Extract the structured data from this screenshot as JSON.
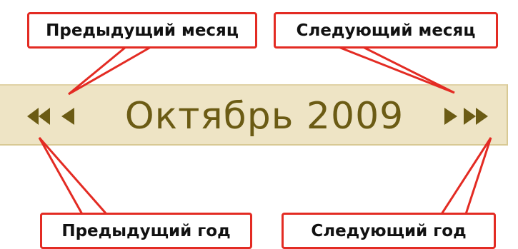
{
  "calendar_header": {
    "title": "Октябрь 2009",
    "colors": {
      "bar_background": "#eee4c5",
      "text_and_arrows": "#6b5b14"
    }
  },
  "callouts": {
    "prev_month": "Предыдущий месяц",
    "next_month": "Следующий месяц",
    "prev_year": "Предыдущий год",
    "next_year": "Следующий год",
    "border_color": "#e32b23"
  },
  "icons": {
    "prev_year": "double-left-triangle-icon",
    "prev_month": "left-triangle-icon",
    "next_month": "right-triangle-icon",
    "next_year": "double-right-triangle-icon"
  }
}
